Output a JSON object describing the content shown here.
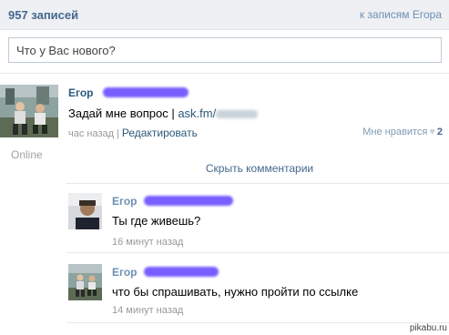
{
  "header": {
    "count_label": "957 записей",
    "back_link": "к записям Егора"
  },
  "composer": {
    "placeholder": "Что у Вас нового?"
  },
  "post": {
    "author_first_name": "Егор",
    "text_prefix": "Задай мне вопрос | ",
    "link_text": "ask.fm/",
    "time": "час назад",
    "separator": "|",
    "edit_label": "Редактировать",
    "like_label": "Мне нравится",
    "like_count": "2",
    "status": "Online"
  },
  "comments_toggle": "Скрыть комментарии",
  "comments": [
    {
      "author_first_name": "Егор",
      "text": "Ты где живешь?",
      "time": "16 минут назад"
    },
    {
      "author_first_name": "Егор",
      "text": "что бы спрашивать, нужно пройти по ссылке",
      "time": "14 минут назад"
    }
  ],
  "watermark": "pikabu.ru",
  "colors": {
    "link": "#2b587a",
    "header_bg": "#eef0f3",
    "muted": "#999999",
    "redaction": "#6a4cff"
  }
}
